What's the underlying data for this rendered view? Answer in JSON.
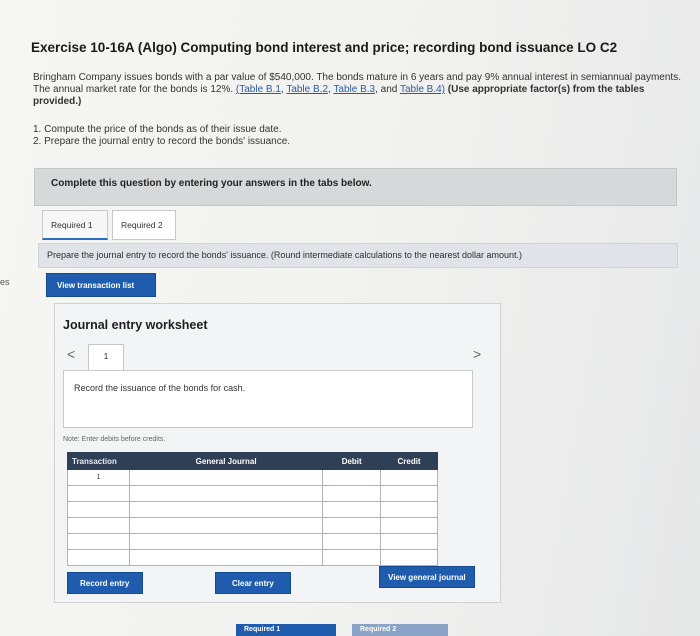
{
  "edge_text": "es",
  "exercise": {
    "title": "Exercise 10-16A (Algo) Computing bond interest and price; recording bond issuance LO C2",
    "intro_part1": "Bringham Company issues bonds with a par value of $540,000. The bonds mature in 6 years and pay 9% annual interest in semiannual payments. The annual market rate for the bonds is 12%. ",
    "table_links": [
      "(Table B.1",
      "Table B.2",
      "Table B.3",
      "and",
      "Table B.4)"
    ],
    "intro_bold": "(Use appropriate factor(s) from the tables provided.)",
    "steps": [
      "1. Compute the price of the bonds as of their issue date.",
      "2. Prepare the journal entry to record the bonds' issuance."
    ]
  },
  "banner": "Complete this question by entering your answers in the tabs below.",
  "tabs": [
    {
      "label": "Required 1"
    },
    {
      "label": "Required 2"
    }
  ],
  "instruction": "Prepare the journal entry to record the bonds' issuance. (Round intermediate calculations to the nearest dollar amount.)",
  "view_transaction_list": "View transaction list",
  "worksheet": {
    "title": "Journal entry worksheet",
    "prev_icon": "<",
    "next_icon": ">",
    "page": "1",
    "description": "Record the issuance of the bonds for cash.",
    "note": "Note: Enter debits before credits.",
    "columns": [
      "Transaction",
      "General Journal",
      "Debit",
      "Credit"
    ],
    "rows": [
      {
        "transaction": "1"
      },
      {
        "transaction": ""
      },
      {
        "transaction": ""
      },
      {
        "transaction": ""
      },
      {
        "transaction": ""
      },
      {
        "transaction": ""
      }
    ],
    "record_entry": "Record entry",
    "clear_entry": "Clear entry",
    "view_general_journal": "View general journal"
  },
  "bottom_buttons": [
    "Required 1",
    "Required 2"
  ]
}
